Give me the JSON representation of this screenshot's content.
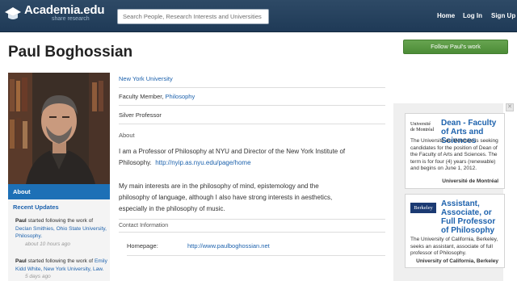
{
  "header": {
    "logo_text": "Academia.edu",
    "logo_tagline": "share research",
    "search_placeholder": "Search People, Research Interests and Universities",
    "nav": {
      "home": "Home",
      "login": "Log In",
      "signup": "Sign Up"
    }
  },
  "profile": {
    "name": "Paul Boghossian",
    "follow_label": "Follow Paul's work",
    "university": "New York University",
    "position_prefix": "Faculty Member,",
    "position_department": "Philosophy",
    "title": "Silver Professor",
    "about_label": "About",
    "bio_line1": "I am a Professor of Philosophy at NYU and Director of the New York Institute of",
    "bio_line2_prefix": "Philosophy.",
    "bio_link": "http://nyip.as.nyu.edu/page/home",
    "interests_line1": "My main interests are in the philosophy of mind, epistemology and the",
    "interests_line2": "philosophy of language, although I also have strong interests in aesthetics,",
    "interests_line3": "especially in the philosophy of music.",
    "contact_label": "Contact Information",
    "homepage_label": "Homepage:",
    "homepage_url": "http://www.paulboghossian.net"
  },
  "sidebar": {
    "about_tab": "About",
    "recent_title": "Recent Updates",
    "updates": [
      {
        "actor": "Paul",
        "text": "started following the work of",
        "links": "Declan Smithies, Ohio State University, Philosophy.",
        "time": "about 10 hours ago"
      },
      {
        "actor": "Paul",
        "text": "started following the work of",
        "links_a": "Emily Kidd White, New York University, Law.",
        "time": "5 days ago"
      }
    ]
  },
  "ads": [
    {
      "logo_line1": "Université",
      "logo_line2": "de Montréal",
      "title": "Dean - Faculty of Arts and Sciences",
      "description": "The Université de Montréal is seeking candidates for the position of Dean of the Faculty of Arts and Sciences. The term is for four (4) years (renewable) and begins on June 1, 2012.",
      "institution": "Université de Montréal"
    },
    {
      "logo_text": "Berkeley",
      "title": "Assistant, Associate, or Full Professor of Philosophy",
      "description": "The University of California, Berkeley, seeks an assistant, associate of full professor of Philosophy.",
      "institution": "University of California, Berkeley"
    }
  ],
  "colors": {
    "header": "#1f3a57",
    "accent": "#1d70b6",
    "follow": "#4c8c37"
  }
}
